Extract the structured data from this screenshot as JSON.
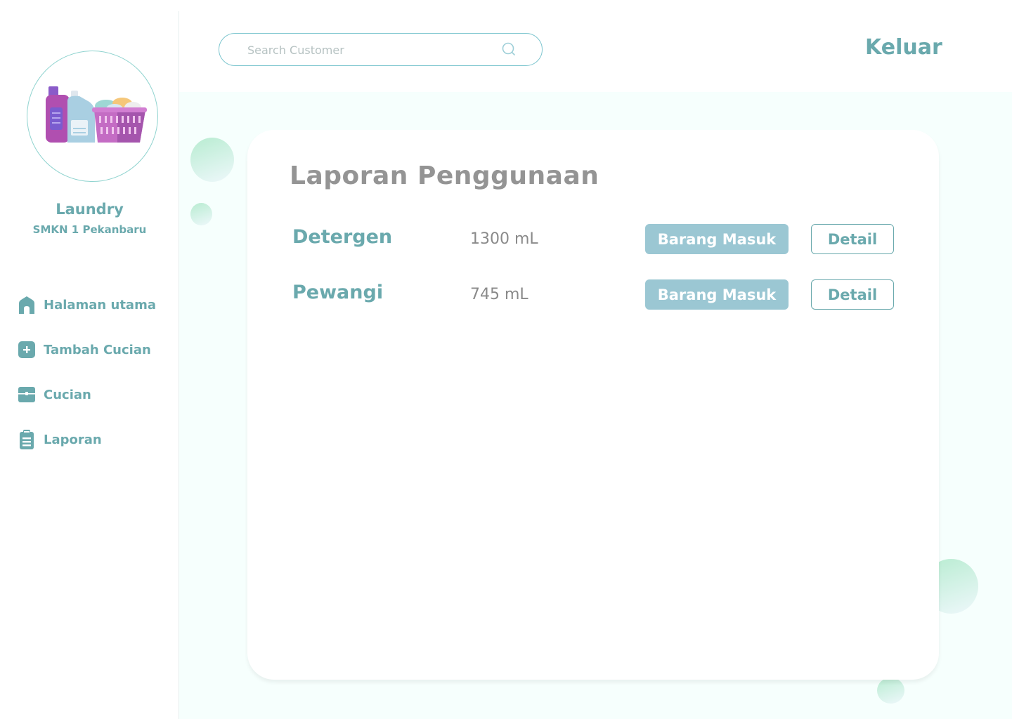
{
  "brand": {
    "title": "Laundry",
    "subtitle": "SMKN 1 Pekanbaru",
    "logo_icon": "laundry-basket-bottles-icon"
  },
  "search": {
    "placeholder": "Search Customer",
    "value": ""
  },
  "header": {
    "logout_label": "Keluar"
  },
  "sidebar": {
    "items": [
      {
        "label": "Halaman utama",
        "icon": "home-icon"
      },
      {
        "label": "Tambah Cucian",
        "icon": "plus-square-icon"
      },
      {
        "label": "Cucian",
        "icon": "box-icon"
      },
      {
        "label": "Laporan",
        "icon": "clipboard-icon"
      }
    ]
  },
  "report": {
    "title": "Laporan Penggunaan",
    "rows": [
      {
        "name": "Detergen",
        "quantity": "1300 mL",
        "in_label": "Barang Masuk",
        "detail_label": "Detail"
      },
      {
        "name": "Pewangi",
        "quantity": "745 mL",
        "in_label": "Barang Masuk",
        "detail_label": "Detail"
      }
    ]
  },
  "colors": {
    "accent": "#6aa9ad",
    "button_fill": "#9bc7d3",
    "title_gray": "#949494",
    "background_tint": "#f6fffd"
  }
}
